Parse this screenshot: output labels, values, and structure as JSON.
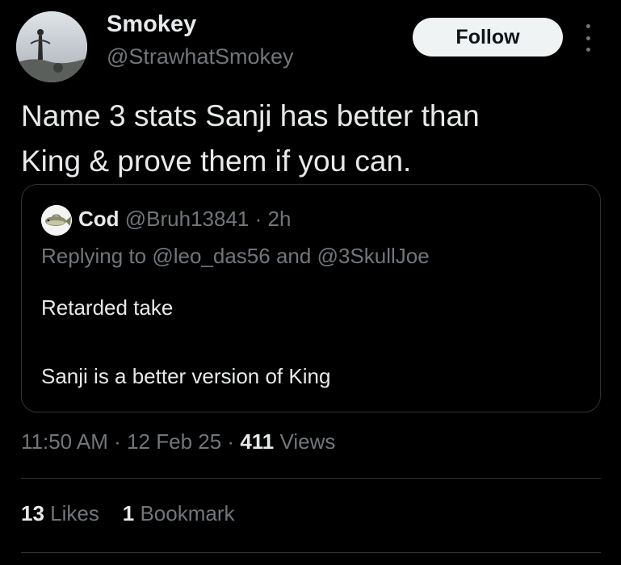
{
  "author": {
    "display_name": "Smokey",
    "handle": "@StrawhatSmokey"
  },
  "follow_label": "Follow",
  "tweet": {
    "text_lines": [
      "Name 3 stats Sanji has better than",
      "King & prove them if you can."
    ]
  },
  "quote": {
    "name": "Cod",
    "handle": "@Bruh13841",
    "separator": "·",
    "time": "2h",
    "replying_prefix": "Replying to",
    "mention_1": "@leo_das56",
    "and_word": "and",
    "mention_2": "@3SkullJoe",
    "lines": [
      "Retarded take",
      "Sanji is a better version of King"
    ]
  },
  "meta": {
    "time": "11:50 AM",
    "separator": "·",
    "date": "12 Feb 25",
    "views_count": "411",
    "views_label": "Views"
  },
  "stats": {
    "likes_count": "13",
    "likes_label": "Likes",
    "bookmarks_count": "1",
    "bookmarks_label": "Bookmark"
  },
  "icons": {
    "more": "more-vertical-icon"
  },
  "colors": {
    "background": "#000000",
    "text_primary": "#e7e9ea",
    "text_secondary": "#71767b",
    "border": "#2f3336",
    "follow_button_bg": "#eff3f4",
    "follow_button_text": "#0f1419"
  }
}
